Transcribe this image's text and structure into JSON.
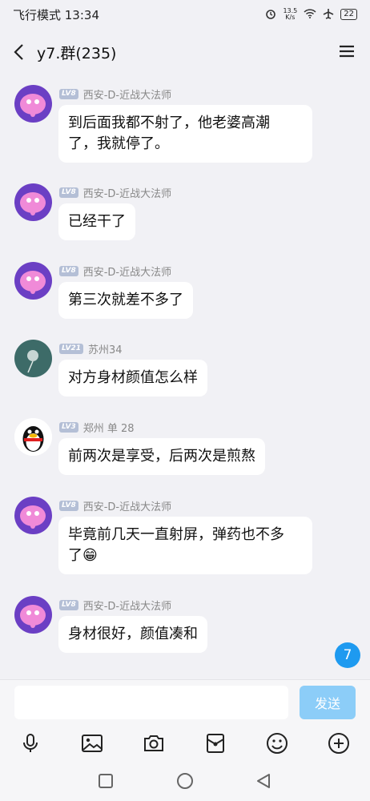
{
  "status": {
    "left": "飞行模式 13:34",
    "speed_top": "13.5",
    "speed_bottom": "K/s",
    "battery": "22"
  },
  "header": {
    "title": "y7.群(235)",
    "back_icon": "chevron-left-icon",
    "menu_icon": "hamburger-menu-icon"
  },
  "messages": [
    {
      "level": "LV8",
      "sender": "西安-D-近战大法师",
      "lines": [
        "到后面我都不射了，他老婆高潮",
        "了，我就停了。"
      ],
      "avatar": "pink-elephant"
    },
    {
      "level": "LV8",
      "sender": "西安-D-近战大法师",
      "lines": [
        "已经干了"
      ],
      "avatar": "pink-elephant"
    },
    {
      "level": "LV8",
      "sender": "西安-D-近战大法师",
      "lines": [
        "第三次就差不多了"
      ],
      "avatar": "pink-elephant"
    },
    {
      "level": "LV21",
      "sender": "苏州34",
      "lines": [
        "对方身材颜值怎么样"
      ],
      "avatar": "dandelion"
    },
    {
      "level": "LV3",
      "sender": "郑州 单 28",
      "lines": [
        "前两次是享受，后两次是煎熬"
      ],
      "avatar": "penguin"
    },
    {
      "level": "LV8",
      "sender": "西安-D-近战大法师",
      "lines": [
        "毕竟前几天一直射屏，弹药也不多",
        "了😁"
      ],
      "avatar": "pink-elephant"
    },
    {
      "level": "LV8",
      "sender": "西安-D-近战大法师",
      "lines": [
        "身材很好，颜值凑和"
      ],
      "avatar": "pink-elephant"
    }
  ],
  "unread_count": "7",
  "input": {
    "value": "",
    "placeholder": ""
  },
  "send_label": "发送",
  "toolbar_icons": [
    "microphone-icon",
    "image-icon",
    "camera-icon",
    "red-packet-icon",
    "emoji-icon",
    "plus-icon"
  ],
  "colors": {
    "accent": "#1e9af0",
    "send_disabled": "#8ccdf8",
    "background": "#f1f1f5"
  }
}
